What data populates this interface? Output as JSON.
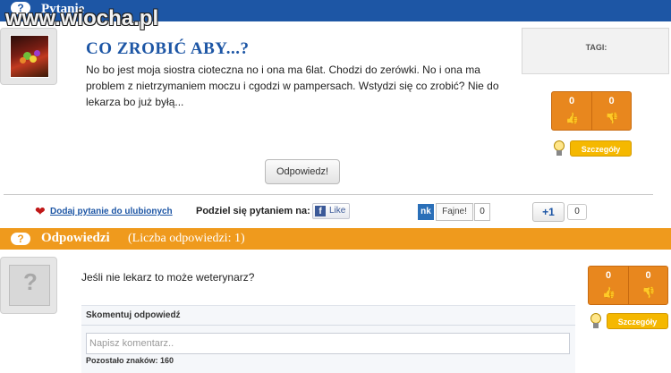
{
  "watermark": "www.wiocha.pl",
  "question_section": {
    "icon": "question-mark-icon",
    "title": "Pytanie"
  },
  "question": {
    "title": "CO ZROBIĆ ABY...?",
    "body": "No bo jest moja siostra cioteczna no i ona ma 6lat. Chodzi do zerówki. No i ona ma problem z nietrzymaniem moczu i cgodzi w pampersach. Wstydzi się co zrobić? Nie do lekarza bo już byłą...",
    "answer_button": "Odpowiedz!",
    "tags_label": "TAGI:",
    "votes": {
      "up": "0",
      "down": "0"
    },
    "details_button": "Szczegóły"
  },
  "share": {
    "favorite_link": "Dodaj pytanie do ulubionych",
    "share_label": "Podziel się pytaniem na:",
    "facebook_like": "Like",
    "nk_logo": "nk",
    "nk_button": "Fajne!",
    "nk_count": "0",
    "gplus_label": "+1",
    "gplus_count": "0"
  },
  "answers_section": {
    "icon": "question-mark-icon",
    "title": "Odpowiedzi",
    "count_text": "(Liczba odpowiedzi: 1)"
  },
  "answer": {
    "text": "Jeśli nie lekarz to może weterynarz?",
    "votes": {
      "up": "0",
      "down": "0"
    },
    "details_button": "Szczegóły",
    "comment_label": "Skomentuj odpowiedź",
    "comment_placeholder": "Napisz komentarz..",
    "chars_left_label": "Pozostało znaków:",
    "chars_left_value": "160"
  },
  "colors": {
    "question_bar": "#1d56a5",
    "answers_bar": "#ef9a1d",
    "vote_box": "#e8871e",
    "details_button": "#f5b800"
  }
}
